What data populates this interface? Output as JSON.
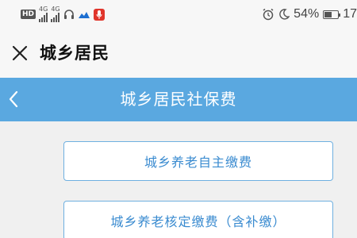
{
  "status_bar": {
    "hd_label": "HD",
    "network_1": "4G",
    "network_2": "4G",
    "battery_text": "54%",
    "time_partial": "17",
    "battery_level": 0.54
  },
  "app_header": {
    "title": "城乡居民"
  },
  "nav": {
    "title": "城乡居民社保费"
  },
  "options": [
    {
      "label": "城乡养老自主缴费"
    },
    {
      "label": "城乡养老核定缴费（含补缴）"
    }
  ],
  "colors": {
    "nav_background": "#5aa8e0",
    "option_text": "#3a8bd0",
    "option_border": "#6fb0e0",
    "page_background": "#f0f0f0",
    "notification_red": "#e0352b"
  },
  "icons": [
    "hd-icon",
    "signal-icon",
    "headphone-icon",
    "cloud-icon",
    "microphone-icon",
    "alarm-icon",
    "moon-icon",
    "battery-icon",
    "close-icon",
    "chevron-left-icon"
  ]
}
